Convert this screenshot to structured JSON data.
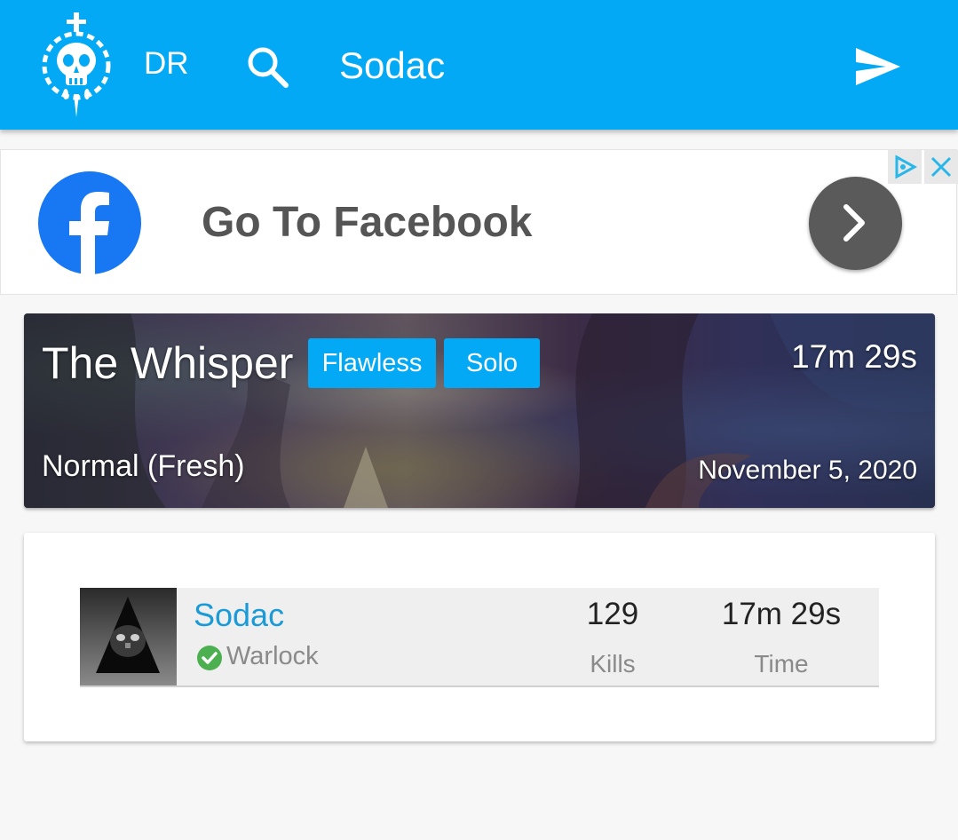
{
  "header": {
    "site_abbrev": "DR",
    "search_query": "Sodac",
    "logo_icon": "skull-dagger-icon",
    "search_icon": "search-icon",
    "send_icon": "send-icon"
  },
  "ad": {
    "title": "Go To Facebook",
    "brand_icon": "facebook-icon",
    "cta_icon": "chevron-right-icon",
    "choices_icon": "adchoices-icon",
    "close_icon": "close-icon"
  },
  "activity": {
    "name": "The Whisper",
    "badges": [
      "Flawless",
      "Solo"
    ],
    "duration": "17m 29s",
    "mode": "Normal (Fresh)",
    "date": "November 5, 2020"
  },
  "player": {
    "name": "Sodac",
    "class": "Warlock",
    "kills": "129",
    "kills_label": "Kills",
    "time": "17m 29s",
    "time_label": "Time"
  },
  "colors": {
    "primary": "#03a9f4",
    "link": "#1a9bd7",
    "facebook": "#1877f2",
    "success": "#4caf50"
  }
}
